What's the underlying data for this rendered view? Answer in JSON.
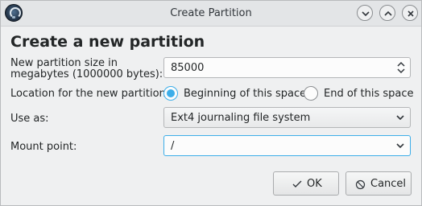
{
  "window": {
    "title": "Create Partition",
    "buttons": {
      "minimize": "chevron-down-icon",
      "maximize": "chevron-up-icon",
      "close": "close-icon"
    }
  },
  "heading": "Create a new partition",
  "size": {
    "label_line1": "New partition size in",
    "label_line2": "megabytes (1000000 bytes):",
    "value": "85000"
  },
  "location": {
    "label": "Location for the new partition:",
    "options": [
      "Beginning of this space",
      "End of this space"
    ],
    "selected": "Beginning of this space"
  },
  "use_as": {
    "label": "Use as:",
    "value": "Ext4 journaling file system"
  },
  "mount_point": {
    "label": "Mount point:",
    "value": "/"
  },
  "actions": {
    "ok": "OK",
    "cancel": "Cancel"
  },
  "colors": {
    "accent": "#3daee9",
    "background": "#eff0f1",
    "text": "#232627"
  }
}
